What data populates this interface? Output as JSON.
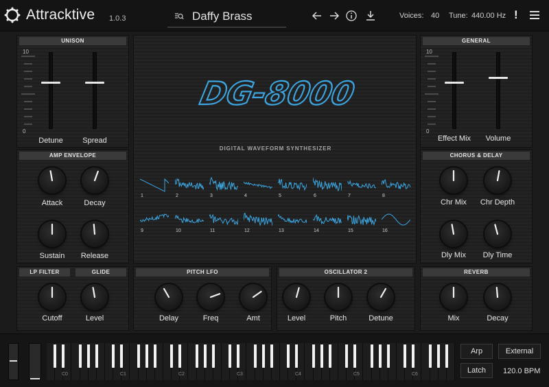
{
  "header": {
    "brand": "Attracktive",
    "version": "1.0.3",
    "preset_name": "Daffy Brass",
    "voices_label": "Voices:",
    "voices_value": "40",
    "tune_label": "Tune:",
    "tune_value": "440.00 Hz",
    "alert": "!"
  },
  "unison": {
    "title": "UNISON",
    "scale_max": "10",
    "scale_min": "0",
    "detune_label": "Detune",
    "spread_label": "Spread",
    "detune_level": 0.62,
    "spread_level": 0.62
  },
  "general": {
    "title": "GENERAL",
    "scale_max": "10",
    "scale_min": "0",
    "effect_mix_label": "Effect Mix",
    "volume_label": "Volume",
    "effect_mix_level": 0.62,
    "volume_level": 0.68
  },
  "amp_envelope": {
    "title": "AMP ENVELOPE",
    "attack": "Attack",
    "decay": "Decay",
    "sustain": "Sustain",
    "release": "Release"
  },
  "chorus_delay": {
    "title": "CHORUS & DELAY",
    "chr_mix": "Chr Mix",
    "chr_depth": "Chr Depth",
    "dly_mix": "Dly Mix",
    "dly_time": "Dly Time"
  },
  "lp_filter": {
    "title": "LP FILTER",
    "cutoff": "Cutoff"
  },
  "glide": {
    "title": "GLIDE",
    "level": "Level"
  },
  "pitch_lfo": {
    "title": "PITCH LFO",
    "delay": "Delay",
    "freq": "Freq",
    "amt": "Amt"
  },
  "oscillator2": {
    "title": "OSCILLATOR 2",
    "level": "Level",
    "pitch": "Pitch",
    "detune": "Detune"
  },
  "reverb": {
    "title": "REVERB",
    "mix": "Mix",
    "decay": "Decay"
  },
  "display": {
    "logo_text": "DG-8000",
    "subtitle": "DIGITAL WAVEFORM SYNTHESIZER",
    "waveforms": [
      "1",
      "2",
      "3",
      "4",
      "5",
      "6",
      "7",
      "8",
      "9",
      "10",
      "11",
      "12",
      "13",
      "14",
      "15",
      "16"
    ]
  },
  "keyboard": {
    "octave_labels": [
      "C0",
      "C1",
      "C2",
      "C3",
      "C4",
      "C5",
      "C6"
    ],
    "arp": "Arp",
    "external": "External",
    "latch": "Latch",
    "bpm": "120.0 BPM"
  },
  "colors": {
    "accent": "#3da6e0",
    "knob_indicator": "#f2f2f2"
  }
}
